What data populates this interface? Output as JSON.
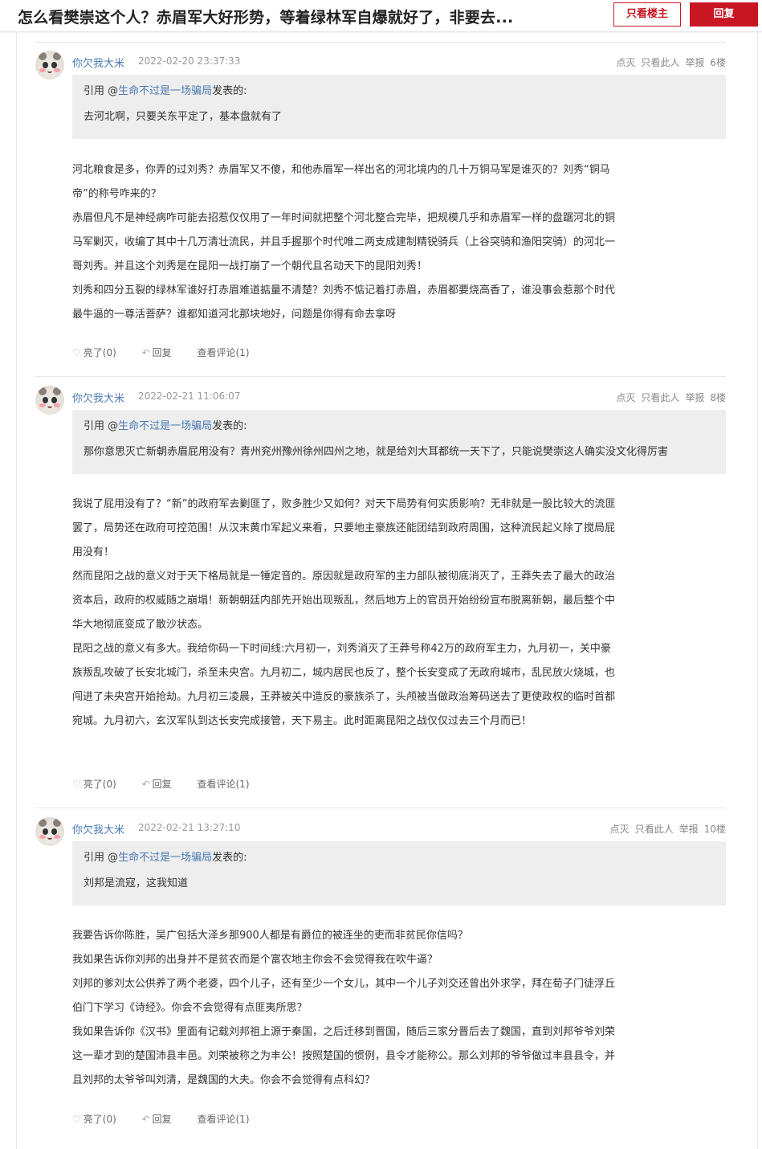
{
  "header": {
    "title": "怎么看樊崇这个人？赤眉军大好形势，等着绿林军自爆就好了，非要去...",
    "only_op_label": "只看楼主",
    "reply_label": "回复"
  },
  "action_labels": {
    "dislike": "点灭",
    "only_this": "只看此人",
    "report": "举报"
  },
  "footer_labels": {
    "like": "亮了(0)",
    "reply": "回复",
    "comments": "查看评论(1)"
  },
  "posts": [
    {
      "author": "你欠我大米",
      "time": "2022-02-20 23:37:33",
      "floor": "6楼",
      "quote": {
        "prefix": "引用 @",
        "user": "生命不过是一场骗局",
        "suffix": "发表的:",
        "text": "去河北啊，只要关东平定了，基本盘就有了"
      },
      "paragraphs": [
        "河北粮食是多，你弄的过刘秀？赤眉军又不傻，和他赤眉军一样出名的河北境内的几十万铜马军是谁灭的？刘秀“铜马帝”的称号咋来的？",
        "赤眉但凡不是神经病咋可能去招惹仅仅用了一年时间就把整个河北整合完毕，把规模几乎和赤眉军一样的盘踞河北的铜马军剿灭，收编了其中十几万清壮流民，并且手握那个时代唯二两支成建制精锐骑兵（上谷突骑和渔阳突骑）的河北一哥刘秀。并且这个刘秀是在昆阳一战打崩了一个朝代且名动天下的昆阳刘秀！",
        "刘秀和四分五裂的绿林军谁好打赤眉难道掂量不清楚？刘秀不惦记着打赤眉，赤眉都要烧高香了，谁没事会惹那个时代最牛逼的一尊活菩萨？谁都知道河北那块地好，问题是你得有命去拿呀"
      ]
    },
    {
      "author": "你欠我大米",
      "time": "2022-02-21 11:06:07",
      "floor": "8楼",
      "quote": {
        "prefix": "引用 @",
        "user": "生命不过是一场骗局",
        "suffix": "发表的:",
        "text": "那你意思灭亡新朝赤眉屁用没有？青州兖州豫州徐州四州之地，就是给刘大耳都统一天下了，只能说樊崇这人确实没文化得厉害"
      },
      "paragraphs": [
        "我说了屁用没有了？“新”的政府军去剿匪了，败多胜少又如何？对天下局势有何实质影响？无非就是一股比较大的流匪罢了，局势还在政府可控范围！从汉末黄巾军起义来看，只要地主豪族还能团结到政府周围，这种流民起义除了搅局屁用没有！",
        "然而昆阳之战的意义对于天下格局就是一锤定音的。原因就是政府军的主力部队被彻底消灭了，王莽失去了最大的政治资本后，政府的权威随之崩塌！新朝朝廷内部先开始出现叛乱，然后地方上的官员开始纷纷宣布脱离新朝，最后整个中华大地彻底变成了散沙状态。",
        "昆阳之战的意义有多大。我给你码一下时间线:六月初一，刘秀消灭了王莽号称42万的政府军主力，九月初一，关中豪族叛乱攻破了长安北城门，杀至未央宫。九月初二，城内居民也反了，整个长安变成了无政府城市，乱民放火烧城，也闯进了未央宫开始抢劫。九月初三凌晨，王莽被关中造反的豪族杀了，头颅被当做政治筹码送去了更使政权的临时首都宛城。九月初六，玄汉军队到达长安完成接管，天下易主。此时距离昆阳之战仅仅过去三个月而已！"
      ]
    },
    {
      "author": "你欠我大米",
      "time": "2022-02-21 13:27:10",
      "floor": "10楼",
      "quote": {
        "prefix": "引用 @",
        "user": "生命不过是一场骗局",
        "suffix": "发表的:",
        "text": "刘邦是流寇，这我知道"
      },
      "paragraphs": [
        "我要告诉你陈胜，吴广包括大泽乡那900人都是有爵位的被连坐的吏而非贫民你信吗？",
        "我如果告诉你刘邦的出身并不是贫农而是个富农地主你会不会觉得我在吹牛逼？",
        "刘邦的爹刘太公供养了两个老婆，四个儿子，还有至少一个女儿，其中一个儿子刘交还曾出外求学，拜在荀子门徒浮丘伯门下学习《诗经》。你会不会觉得有点匪夷所思？",
        "我如果告诉你《汉书》里面有记载刘邦祖上源于秦国，之后迁移到晋国，随后三家分晋后去了魏国，直到刘邦爷爷刘荣这一辈才到的楚国沛县丰邑。刘荣被称之为丰公！按照楚国的惯例，县令才能称公。那么刘邦的爷爷做过丰县县令，并且刘邦的太爷爷叫刘清，是魏国的大夫。你会不会觉得有点科幻？"
      ]
    }
  ]
}
